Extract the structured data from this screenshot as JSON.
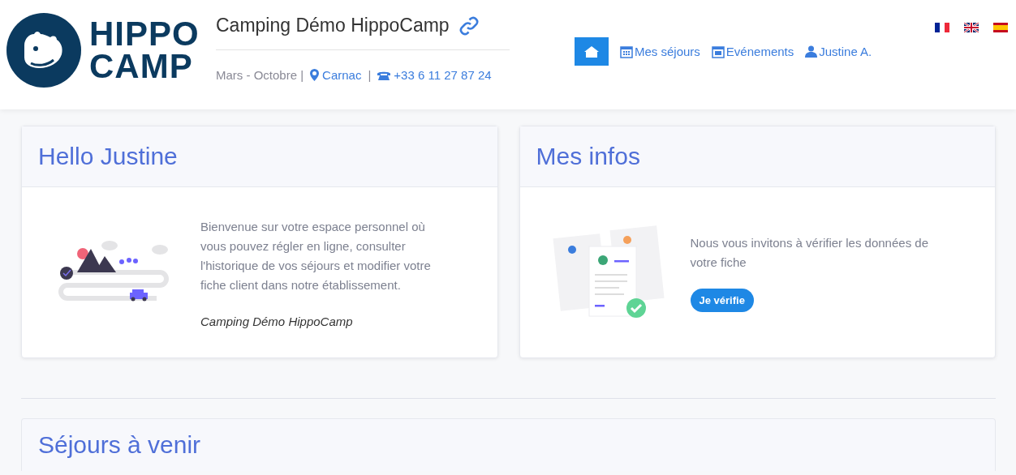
{
  "logo": {
    "line_1": "HIPPO",
    "line_2": "CAMP"
  },
  "camping": {
    "name": "Camping Démo HippoCamp",
    "season": "Mars - Octobre |",
    "city": "Carnac",
    "city_separator": "|",
    "phone": "+33 6 11 27 87 24"
  },
  "nav": [
    {
      "kind": "home",
      "selected": true
    },
    {
      "kind": "calendar",
      "label": "Mes séjours",
      "selected": false
    },
    {
      "kind": "events",
      "label": "Evénements",
      "selected": false
    },
    {
      "kind": "user",
      "label": "Justine A.",
      "selected": false
    }
  ],
  "cards": [
    {
      "kind": "welcome",
      "title": "Hello Justine",
      "text": "Bienvenue sur votre espace personnel où vous pouvez régler en ligne, consulter l'historique de vos séjours et modifier votre fiche client dans notre établissement.",
      "signature": "Camping Démo HippoCamp"
    },
    {
      "kind": "info",
      "title": "Mes infos",
      "text": "Nous vous invitons à vérifier les données de votre fiche",
      "button": "Je vérifie"
    }
  ],
  "upcoming": {
    "title": "Séjours à venir"
  }
}
